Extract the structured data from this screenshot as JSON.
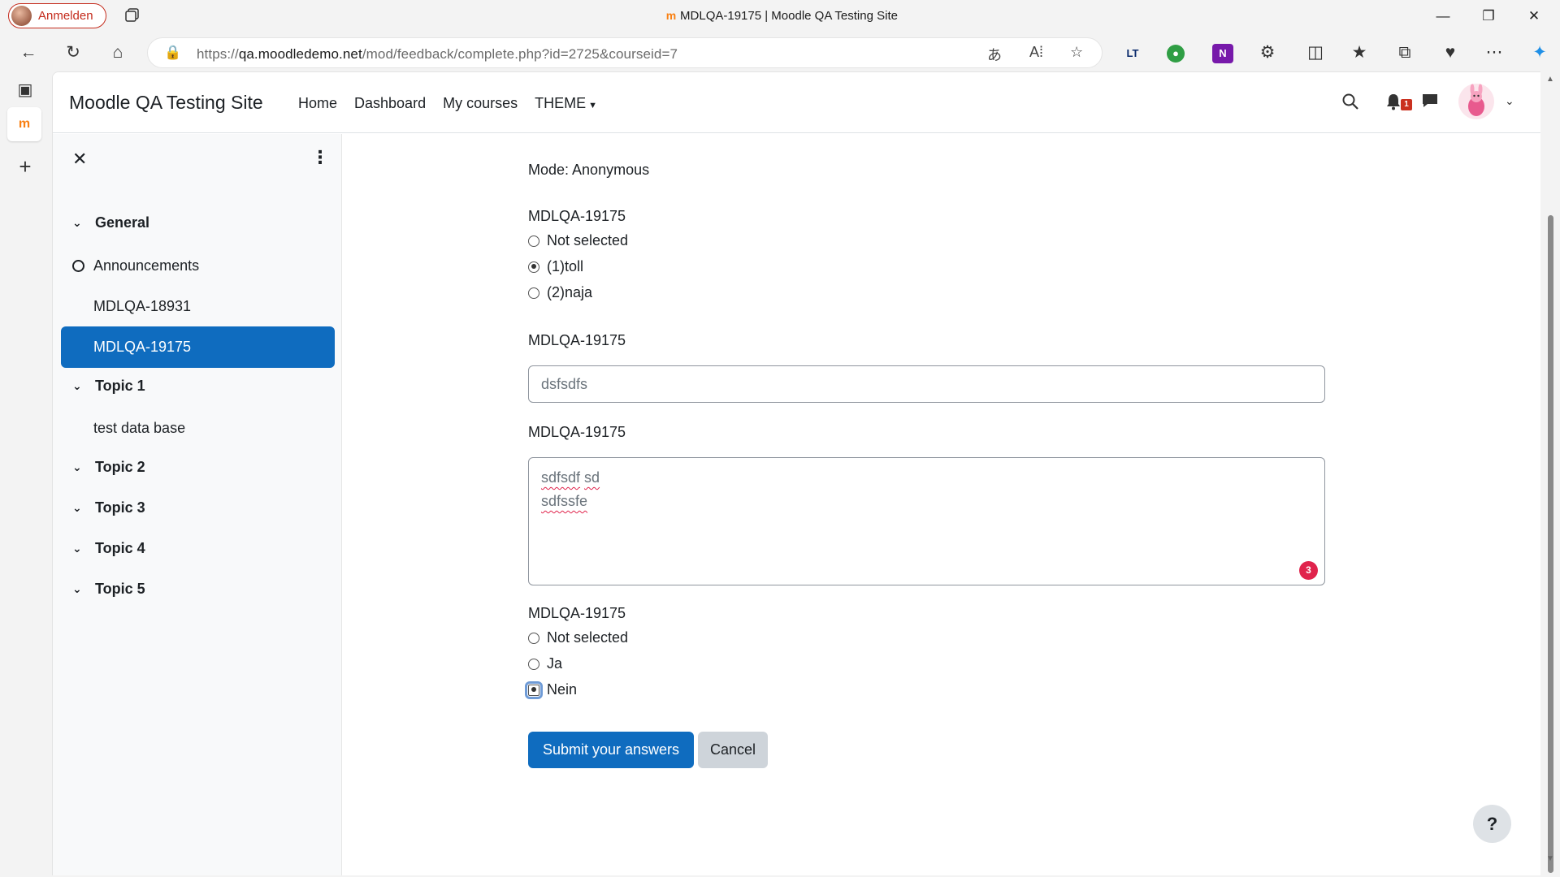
{
  "browser": {
    "profile_label": "Anmelden",
    "tab_title": "MDLQA-19175 | Moodle QA Testing Site",
    "url_prefix": "https://",
    "url_domain": "qa.moodledemo.net",
    "url_path": "/mod/feedback/complete.php?id=2725&courseid=7",
    "ext_lt": "LT",
    "ext_onenote": "N",
    "favicon": "m"
  },
  "header": {
    "site_name": "Moodle QA Testing Site",
    "nav": [
      "Home",
      "Dashboard",
      "My courses",
      "THEME"
    ],
    "notification_count": "1"
  },
  "course_index": {
    "sections": [
      {
        "label": "General",
        "items": [
          {
            "label": "Announcements",
            "active": false
          },
          {
            "label": "MDLQA-18931",
            "active": false
          },
          {
            "label": "MDLQA-19175",
            "active": true
          }
        ]
      },
      {
        "label": "Topic 1",
        "items": [
          {
            "label": "test data base",
            "active": false
          }
        ]
      },
      {
        "label": "Topic 2",
        "items": []
      },
      {
        "label": "Topic 3",
        "items": []
      },
      {
        "label": "Topic 4",
        "items": []
      },
      {
        "label": "Topic 5",
        "items": []
      }
    ]
  },
  "main": {
    "mode": "Mode: Anonymous",
    "q1": {
      "label": "MDLQA-19175",
      "options": [
        "Not selected",
        "(1)toll",
        "(2)naja"
      ],
      "selected": "(1)toll"
    },
    "q2": {
      "label": "MDLQA-19175",
      "value": "dsfsdfs"
    },
    "q3": {
      "label": "MDLQA-19175",
      "line1_a": "sdfsdf",
      "line1_b": "sd",
      "line2": "sdfssfe",
      "grammar_count": "3"
    },
    "q4": {
      "label": "MDLQA-19175",
      "options": [
        "Not selected",
        "Ja",
        "Nein"
      ],
      "selected": "Nein"
    },
    "submit_label": "Submit your answers",
    "cancel_label": "Cancel"
  },
  "help_label": "?"
}
